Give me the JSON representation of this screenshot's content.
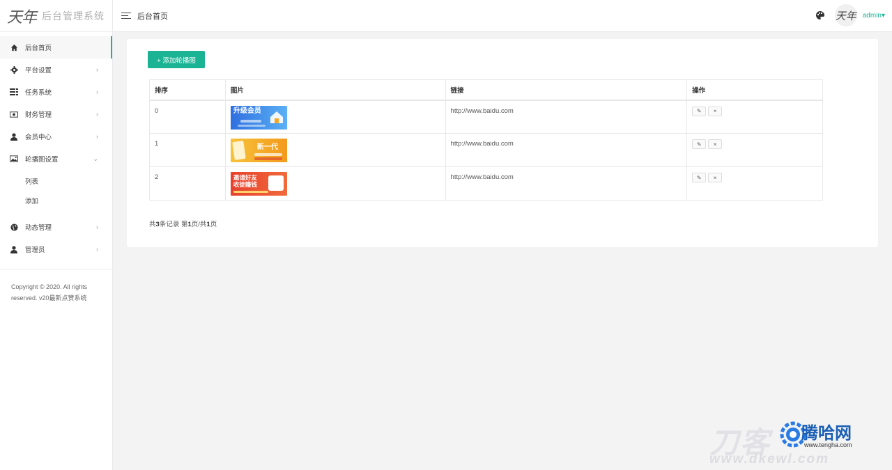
{
  "brand": {
    "logo": "天年",
    "title": "后台管理系统"
  },
  "topbar": {
    "breadcrumb": "后台首页",
    "avatar_text": "天年",
    "user": "admin▾"
  },
  "sidebar": {
    "items": [
      {
        "label": "后台首页",
        "icon": "home-icon",
        "arrow": ""
      },
      {
        "label": "平台设置",
        "icon": "gear-icon",
        "arrow": "›"
      },
      {
        "label": "任务系统",
        "icon": "tasks-icon",
        "arrow": "›"
      },
      {
        "label": "财务管理",
        "icon": "money-icon",
        "arrow": "›"
      },
      {
        "label": "会员中心",
        "icon": "user-icon",
        "arrow": "›"
      },
      {
        "label": "轮播图设置",
        "icon": "image-icon",
        "arrow": "⌄"
      }
    ],
    "subitems": [
      {
        "label": "列表"
      },
      {
        "label": "添加"
      }
    ],
    "items2": [
      {
        "label": "动态管理",
        "icon": "globe-icon",
        "arrow": "›"
      },
      {
        "label": "管理员",
        "icon": "user-icon",
        "arrow": "›"
      }
    ],
    "copyright_line1": "Copyright © 2020. All rights",
    "copyright_line2": "reserved. v20最新点赞系统"
  },
  "content": {
    "add_button": "+ 添加轮播图",
    "table": {
      "headers": [
        "排序",
        "图片",
        "链接",
        "操作"
      ],
      "rows": [
        {
          "sort": "0",
          "banner_text": "升级会员",
          "link": "http://www.baidu.com"
        },
        {
          "sort": "1",
          "banner_text": "新一代",
          "link": "http://www.baidu.com"
        },
        {
          "sort": "2",
          "banner_text": "邀请好友 收徒赚钱",
          "link": "http://www.baidu.com"
        }
      ],
      "edit_icon": "✎",
      "delete_icon": "×"
    },
    "pager": {
      "prefix": "共",
      "total": "3",
      "mid": "条记录 第",
      "page": "1",
      "sep": "页/共",
      "pages": "1",
      "suffix": "页"
    }
  },
  "watermark": {
    "big": "刀客",
    "cn": "腾哈网",
    "site": "www.tengha.com",
    "url": "www.dkewl.com"
  },
  "colors": {
    "accent": "#1ab394",
    "banner0": "#2f6fe0",
    "banner1": "#f5b41e",
    "banner2": "#e8402e"
  }
}
